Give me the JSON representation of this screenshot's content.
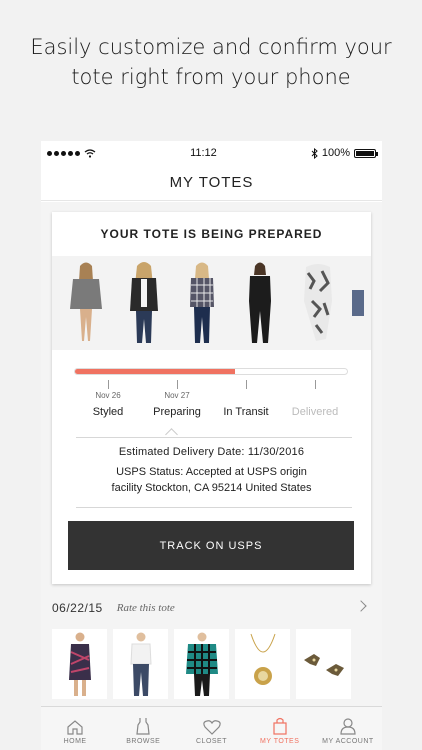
{
  "promo": {
    "line1": "Easily customize and confirm your",
    "line2": "tote right from your phone"
  },
  "status_bar": {
    "time": "11:12",
    "battery": "100%"
  },
  "nav": {
    "title": "MY TOTES"
  },
  "current_tote": {
    "title": "YOUR TOTE IS BEING PREPARED",
    "items": [
      {
        "icon": "grey-sweater-outfit",
        "color": "#7a7a7a"
      },
      {
        "icon": "black-blazer-outfit",
        "color": "#2a2a2a"
      },
      {
        "icon": "plaid-top-outfit",
        "color": "#555566"
      },
      {
        "icon": "black-jumpsuit-outfit",
        "color": "#1c1c1c"
      },
      {
        "icon": "patterned-scarf",
        "color": "#888888"
      }
    ],
    "progress": {
      "fraction": 0.59,
      "accent": "#f07261",
      "steps": [
        {
          "date": "Nov 26",
          "label": "Styled",
          "active": true
        },
        {
          "date": "Nov 27",
          "label": "Preparing",
          "active": true
        },
        {
          "date": "",
          "label": "In Transit",
          "active": true
        },
        {
          "date": "",
          "label": "Delivered",
          "active": false
        }
      ]
    },
    "estimated_delivery": "Estimated Delivery Date: 11/30/2016",
    "usps_status_line1": "USPS Status: Accepted at USPS origin",
    "usps_status_line2": "facility Stockton, CA 95214 United States",
    "track_button": "TRACK ON USPS"
  },
  "past_tote": {
    "date": "06/22/15",
    "rate_label": "Rate this tote",
    "items": [
      {
        "icon": "printed-dress",
        "color": "#3a2f4a"
      },
      {
        "icon": "white-tee-outfit",
        "color": "#3c4a66"
      },
      {
        "icon": "teal-plaid-top",
        "color": "#1f8a85"
      },
      {
        "icon": "pendant-necklace",
        "color": "#c9a24a"
      },
      {
        "icon": "bird-earrings",
        "color": "#6b5a3a"
      }
    ]
  },
  "tabbar": {
    "tabs": [
      {
        "label": "HOME",
        "icon": "home-icon",
        "active": false
      },
      {
        "label": "BROWSE",
        "icon": "dress-icon",
        "active": false
      },
      {
        "label": "CLOSET",
        "icon": "heart-icon",
        "active": false
      },
      {
        "label": "MY TOTES",
        "icon": "tote-bag-icon",
        "active": true
      },
      {
        "label": "MY ACCOUNT",
        "icon": "account-icon",
        "active": false
      }
    ]
  }
}
